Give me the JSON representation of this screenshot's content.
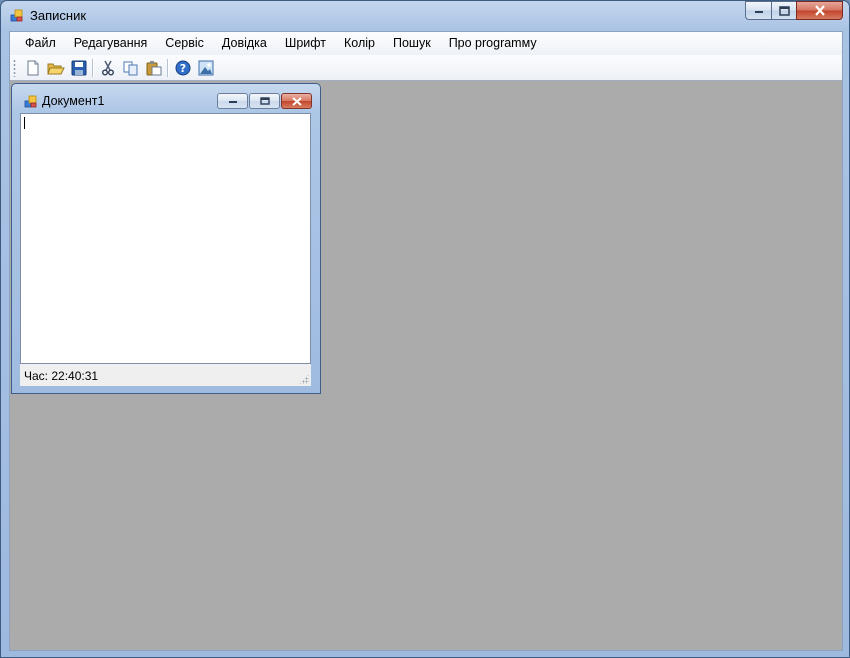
{
  "window": {
    "title": "Записник"
  },
  "menu": {
    "items": [
      "Файл",
      "Редагування",
      "Сервіс",
      "Довідка",
      "Шрифт",
      "Колір",
      "Пошук",
      "Про programму"
    ]
  },
  "toolbar": {
    "buttons": [
      "new-document-icon",
      "open-folder-icon",
      "save-icon",
      "cut-icon",
      "copy-icon",
      "paste-icon",
      "help-icon",
      "image-icon"
    ]
  },
  "document": {
    "title": "Документ1",
    "text": "",
    "status": "Час: 22:40:31"
  },
  "colors": {
    "mdi_background": "#ababab",
    "close_button": "#c2432c",
    "title_gradient": "#a9c3e4"
  }
}
